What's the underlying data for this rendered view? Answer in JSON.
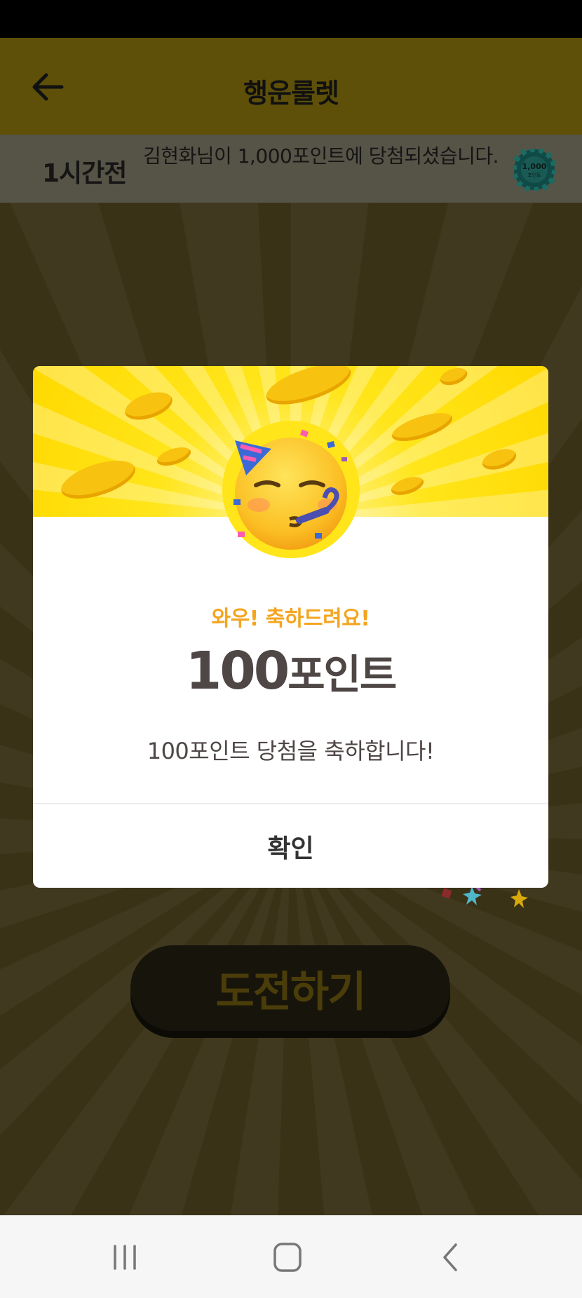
{
  "header": {
    "title": "행운룰렛"
  },
  "ticker": {
    "time": "1시간전",
    "message": "김현화님이 1,000포인트에 당첨되셨습니다.",
    "chip_value": "1,000",
    "chip_caption": "포인트"
  },
  "modal": {
    "congrats": "와우! 축하드려요!",
    "points_value": "100",
    "points_unit": "포인트",
    "message": "100포인트 당첨을 축하합니다!",
    "confirm_label": "확인"
  },
  "main": {
    "challenge_label": "도전하기"
  },
  "colors": {
    "accent_yellow": "#ffe51a",
    "congrats_orange": "#f4a51f",
    "text_dark": "#4f4646"
  },
  "icons": {
    "back": "arrow-left-icon",
    "chip": "casino-chip-icon",
    "emoji": "partying-face-icon",
    "nav_recent": "recent-apps-icon",
    "nav_home": "home-icon",
    "nav_back": "chevron-left-icon"
  }
}
